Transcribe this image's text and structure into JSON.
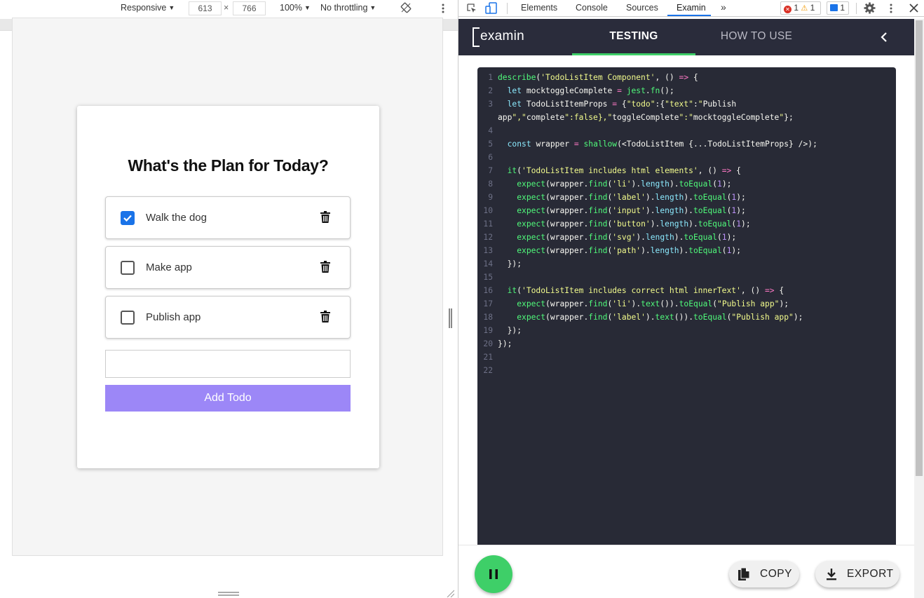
{
  "device_toolbar": {
    "mode": "Responsive",
    "width": "613",
    "times": "×",
    "height": "766",
    "zoom": "100%",
    "throttling": "No throttling"
  },
  "todo_app": {
    "title": "What's the Plan for Today?",
    "items": [
      {
        "label": "Walk the dog",
        "checked": true
      },
      {
        "label": "Make app",
        "checked": false
      },
      {
        "label": "Publish app",
        "checked": false
      }
    ],
    "input_value": "",
    "add_button": "Add Todo"
  },
  "devtools": {
    "tabs": [
      "Elements",
      "Console",
      "Sources",
      "Examin"
    ],
    "active_tab": "Examin",
    "more": "»",
    "errors": "1",
    "warnings": "1",
    "messages": "1"
  },
  "examin": {
    "logo": "examin",
    "tabs": {
      "testing": "TESTING",
      "how_to_use": "HOW TO USE"
    },
    "active_tab": "TESTING",
    "copy_button": "COPY",
    "export_button": "EXPORT",
    "accent_color": "#3ecf68",
    "code_lines": [
      "describe('TodoListItem Component', () => {",
      "  let mocktoggleComplete = jest.fn();",
      "  let TodoListItemProps = {\"todo\":{\"text\":\"Publish",
      "app\",\"complete\":false},\"toggleComplete\":\"mocktoggleComplete\"};",
      "",
      "  const wrapper = shallow(<TodoListItem {...TodoListItemProps} />);",
      "",
      "  it('TodoListItem includes html elements', () => {",
      "    expect(wrapper.find('li').length).toEqual(1);",
      "    expect(wrapper.find('label').length).toEqual(1);",
      "    expect(wrapper.find('input').length).toEqual(1);",
      "    expect(wrapper.find('button').length).toEqual(1);",
      "    expect(wrapper.find('svg').length).toEqual(1);",
      "    expect(wrapper.find('path').length).toEqual(1);",
      "  });",
      "",
      "  it('TodoListItem includes correct html innerText', () => {",
      "    expect(wrapper.find('li').text()).toEqual(\"Publish app\");",
      "    expect(wrapper.find('label').text()).toEqual(\"Publish app\");",
      "  });",
      "});",
      "",
      ""
    ],
    "line_numbers": [
      "1",
      "2",
      "3",
      "",
      "4",
      "5",
      "6",
      "7",
      "8",
      "9",
      "10",
      "11",
      "12",
      "13",
      "14",
      "15",
      "16",
      "17",
      "18",
      "19",
      "20",
      "21",
      "22"
    ]
  }
}
